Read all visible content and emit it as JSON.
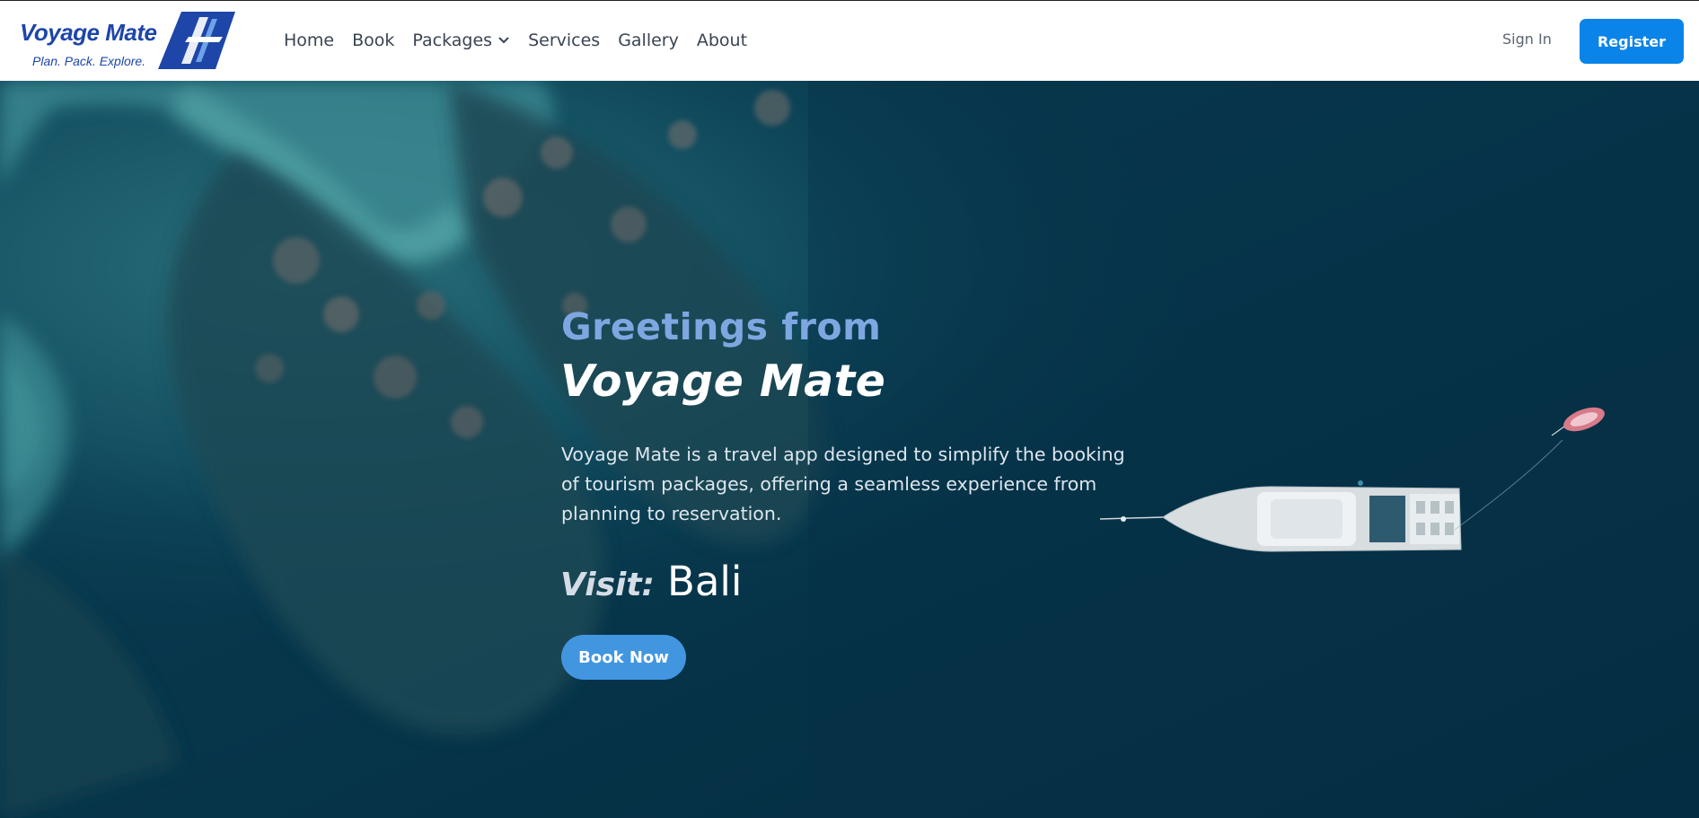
{
  "brand": {
    "name": "Voyage Mate",
    "tagline": "Plan. Pack. Explore.",
    "logo_color": "#1e46a8"
  },
  "nav": {
    "links": [
      {
        "label": "Home"
      },
      {
        "label": "Book"
      },
      {
        "label": "Packages",
        "icon": "chevron-down-icon"
      },
      {
        "label": "Services"
      },
      {
        "label": "Gallery"
      },
      {
        "label": "About"
      }
    ],
    "sign_in": "Sign In",
    "register": "Register"
  },
  "hero": {
    "greeting": "Greetings from",
    "brand_line": "Voyage Mate",
    "description": "Voyage Mate is a travel app designed to simplify the booking of tourism packages, offering a seamless experience from planning to reservation.",
    "visit_label": "Visit:",
    "visit_place": "Bali",
    "cta": "Book Now"
  },
  "colors": {
    "accent": "#0a84e8",
    "cta": "#4296e0",
    "greeting": "#7ea7e2",
    "ocean": "#06344a"
  }
}
